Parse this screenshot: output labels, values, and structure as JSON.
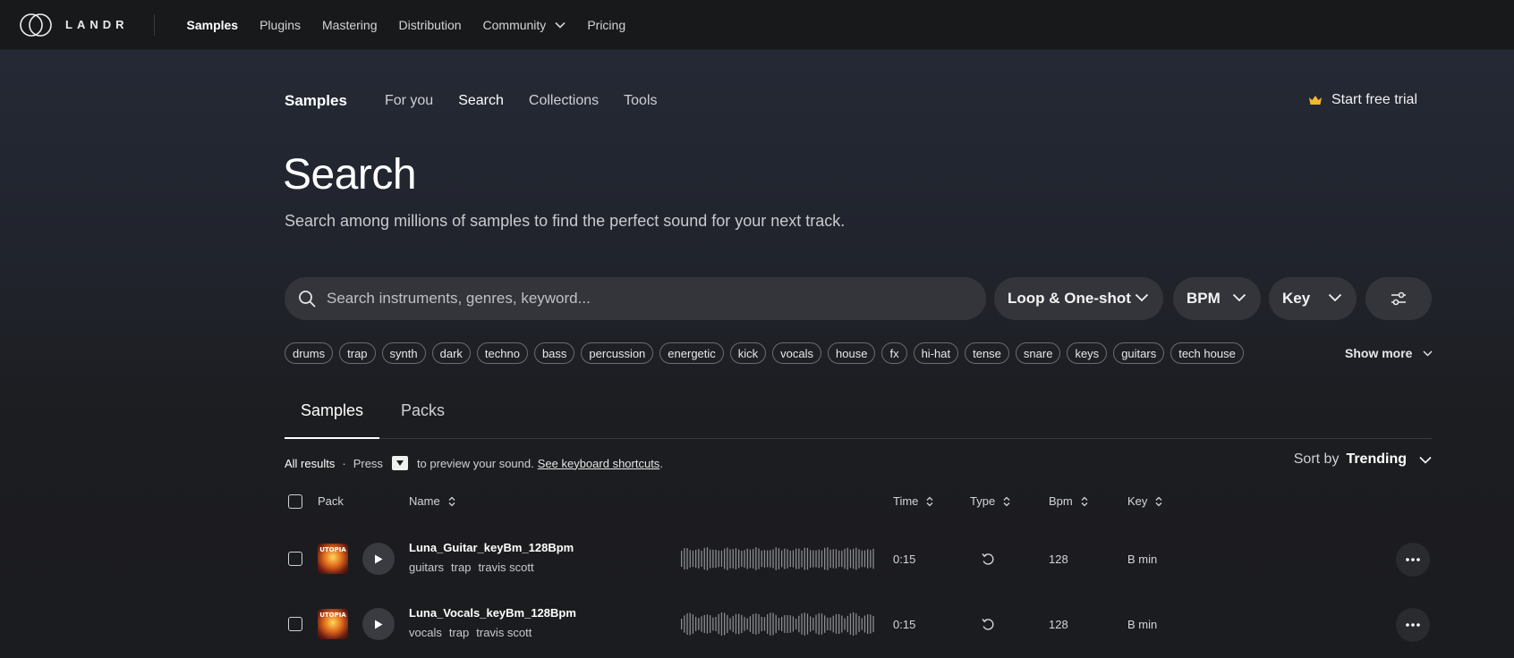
{
  "topbar": {
    "logo_text": "LANDR",
    "nav": [
      {
        "label": "Samples",
        "active": true
      },
      {
        "label": "Plugins"
      },
      {
        "label": "Mastering"
      },
      {
        "label": "Distribution"
      },
      {
        "label": "Community",
        "has_dropdown": true
      },
      {
        "label": "Pricing"
      }
    ]
  },
  "subnav": {
    "brand": "Samples",
    "items": [
      {
        "label": "For you"
      },
      {
        "label": "Search",
        "active": true
      },
      {
        "label": "Collections"
      },
      {
        "label": "Tools"
      }
    ],
    "trial_label": "Start free trial",
    "trial_icon": "crown-icon",
    "trial_icon_color": "#f5b82e"
  },
  "header": {
    "title": "Search",
    "subtitle": "Search among millions of samples to find the perfect sound for your next track."
  },
  "search": {
    "placeholder": "Search instruments, genres, keyword...",
    "value": ""
  },
  "filters": {
    "loop": "Loop & One-shot",
    "bpm": "BPM",
    "key": "Key"
  },
  "tags": [
    "drums",
    "trap",
    "synth",
    "dark",
    "techno",
    "bass",
    "percussion",
    "energetic",
    "kick",
    "vocals",
    "house",
    "fx",
    "hi-hat",
    "tense",
    "snare",
    "keys",
    "guitars",
    "tech house"
  ],
  "show_more": "Show more",
  "tabs": {
    "samples": "Samples",
    "packs": "Packs",
    "active": "samples"
  },
  "results": {
    "all_results": "All results",
    "separator": "·",
    "press": "Press",
    "to_preview": "to preview your sound.",
    "shortcuts_link": "See keyboard shortcuts",
    "period": "."
  },
  "sort": {
    "label": "Sort by",
    "value": "Trending"
  },
  "table": {
    "headers": {
      "pack": "Pack",
      "name": "Name",
      "time": "Time",
      "type": "Type",
      "bpm": "Bpm",
      "key": "Key"
    },
    "rows": [
      {
        "name": "Luna_Guitar_keyBm_128Bpm",
        "tags": [
          "guitars",
          "trap",
          "travis scott"
        ],
        "time": "0:15",
        "type_icon": "loop-icon",
        "bpm": "128",
        "key": "B min",
        "cover_text": "UTOPIA"
      },
      {
        "name": "Luna_Vocals_keyBm_128Bpm",
        "tags": [
          "vocals",
          "trap",
          "travis scott"
        ],
        "time": "0:15",
        "type_icon": "loop-icon",
        "bpm": "128",
        "key": "B min",
        "cover_text": "UTOPIA"
      }
    ]
  }
}
